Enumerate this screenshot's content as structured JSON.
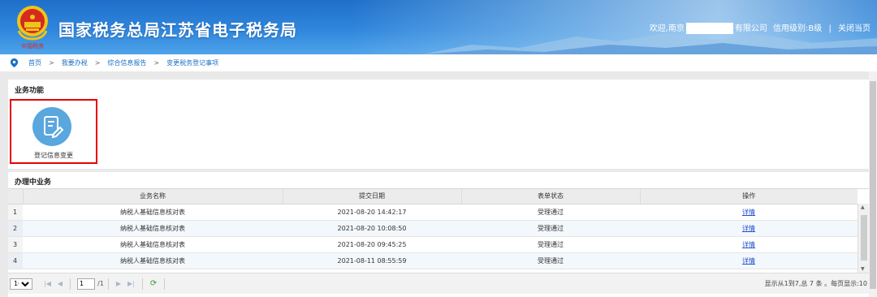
{
  "header": {
    "title": "国家税务总局江苏省电子税务局",
    "logo_caption": "中国税务",
    "welcome_prefix": "欢迎,南京",
    "welcome_suffix": "有限公司",
    "credit_level": "信用级别:B级",
    "separator": "|",
    "close_label": "关闭当页"
  },
  "breadcrumb": {
    "items": [
      "首页",
      "我要办税",
      "综合信息报告",
      "变更税务登记事项"
    ],
    "separator": ">"
  },
  "functions": {
    "title": "业务功能",
    "items": [
      {
        "label": "登记信息变更",
        "icon": "edit-document-icon"
      }
    ]
  },
  "in_progress": {
    "title": "办理中业务",
    "columns": [
      "业务名称",
      "提交日期",
      "表单状态",
      "操作"
    ],
    "rows": [
      {
        "num": "1",
        "name": "纳税人基础信息核对表",
        "date": "2021-08-20 14:42:17",
        "status": "受理通过",
        "action": "详情"
      },
      {
        "num": "2",
        "name": "纳税人基础信息核对表",
        "date": "2021-08-20 10:08:50",
        "status": "受理通过",
        "action": "详情"
      },
      {
        "num": "3",
        "name": "纳税人基础信息核对表",
        "date": "2021-08-20 09:45:25",
        "status": "受理通过",
        "action": "详情"
      },
      {
        "num": "4",
        "name": "纳税人基础信息核对表",
        "date": "2021-08-11 08:55:59",
        "status": "受理通过",
        "action": "详情"
      }
    ]
  },
  "pager": {
    "page_size": "10",
    "current_page": "1",
    "total_pages": "/1",
    "summary": "显示从1到7,总 7 条 。每页显示:10"
  },
  "colors": {
    "header_blue": "#2f86dc",
    "link_blue": "#1c4fcc",
    "highlight_red": "#e60000",
    "icon_bg": "#5aa6df"
  }
}
